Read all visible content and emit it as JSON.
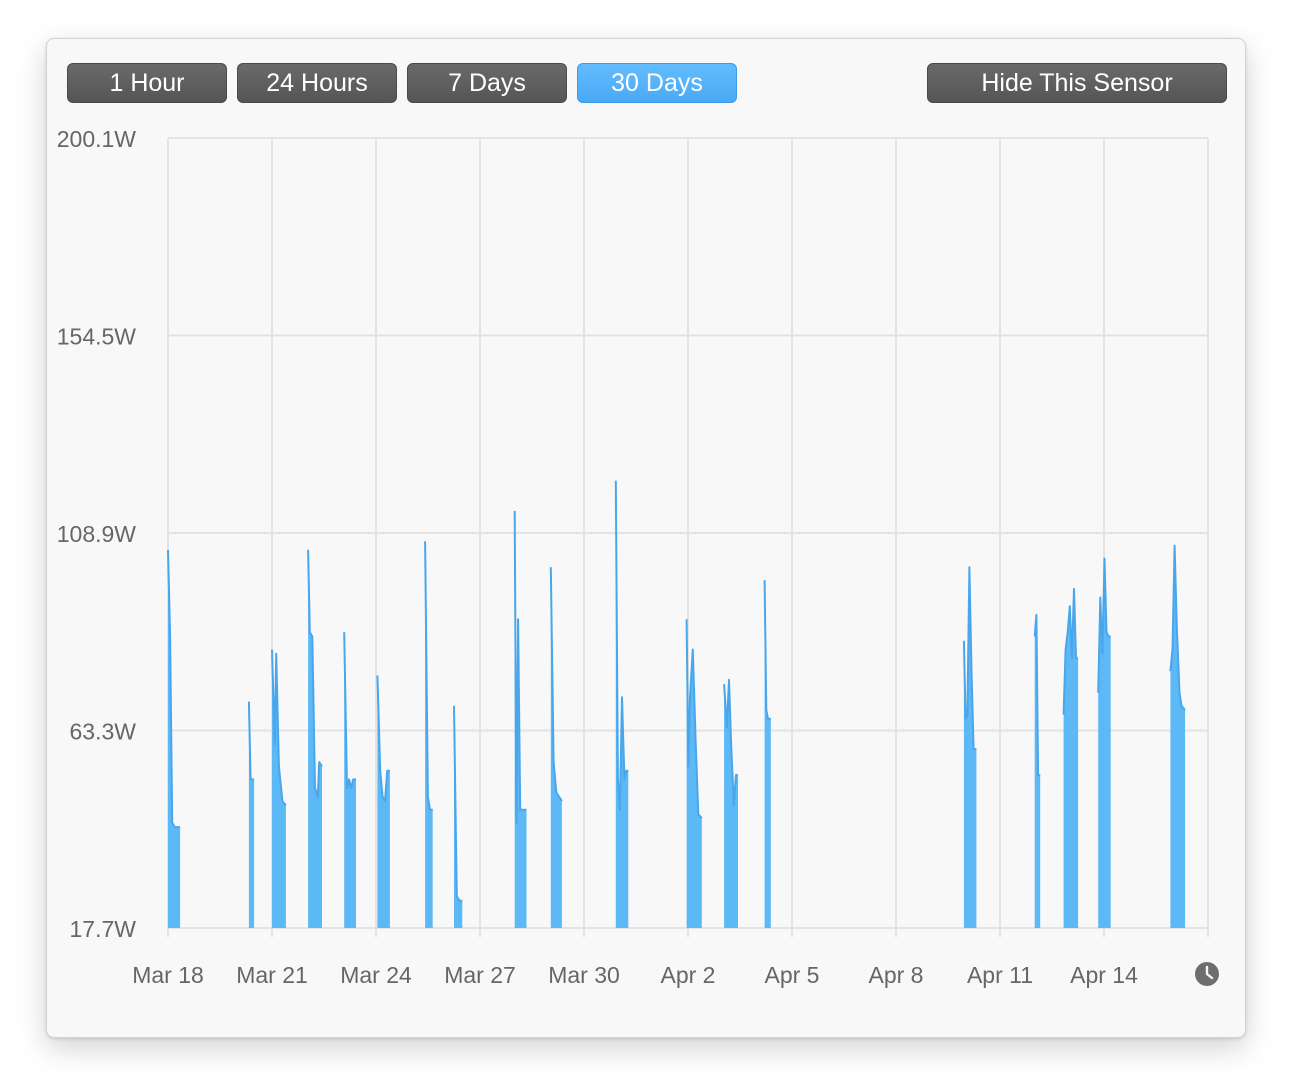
{
  "toolbar": {
    "ranges": [
      "1 Hour",
      "24 Hours",
      "7 Days",
      "30 Days"
    ],
    "selected": "30 Days",
    "hide_label": "Hide This Sensor"
  },
  "colors": {
    "accent": "#5db8f6",
    "line": "#4aa6ea",
    "grid": "#e3e3e3",
    "text": "#666666",
    "button": "#5c5c5c"
  },
  "icons": {
    "time": "clock-icon"
  },
  "chart_data": {
    "type": "area",
    "title": "",
    "xlabel": "",
    "ylabel": "",
    "y_ticks": [
      "200.1W",
      "154.5W",
      "108.9W",
      "63.3W",
      "17.7W"
    ],
    "ylim": [
      17.7,
      200.1
    ],
    "x_ticks": [
      "Mar 18",
      "Mar 21",
      "Mar 24",
      "Mar 27",
      "Mar 30",
      "Apr 2",
      "Apr 5",
      "Apr 8",
      "Apr 11",
      "Apr 14"
    ],
    "xlim": [
      "2024-03-18",
      "2024-04-17"
    ],
    "grid": true,
    "unit": "W",
    "series": [
      {
        "bursts": [
          {
            "start": "2024-03-18 00:00",
            "points": [
              [
                0,
                105
              ],
              [
                0.06,
                85
              ],
              [
                0.12,
                42
              ],
              [
                0.2,
                41
              ],
              [
                0.35,
                41
              ]
            ]
          },
          {
            "start": "2024-03-20 08:00",
            "points": [
              [
                0,
                70
              ],
              [
                0.05,
                52
              ],
              [
                0.15,
                52
              ]
            ]
          },
          {
            "start": "2024-03-21 00:00",
            "points": [
              [
                0,
                82
              ],
              [
                0.08,
                60
              ],
              [
                0.12,
                81
              ],
              [
                0.2,
                55
              ],
              [
                0.3,
                47
              ],
              [
                0.4,
                46
              ]
            ]
          },
          {
            "start": "2024-03-22 01:00",
            "points": [
              [
                0,
                105
              ],
              [
                0.05,
                86
              ],
              [
                0.12,
                85
              ],
              [
                0.2,
                50
              ],
              [
                0.28,
                48
              ],
              [
                0.32,
                56
              ],
              [
                0.4,
                55
              ]
            ]
          },
          {
            "start": "2024-03-23 02:00",
            "points": [
              [
                0,
                86
              ],
              [
                0.08,
                50
              ],
              [
                0.14,
                52
              ],
              [
                0.2,
                50
              ],
              [
                0.26,
                52
              ],
              [
                0.34,
                52
              ]
            ]
          },
          {
            "start": "2024-03-24 01:00",
            "points": [
              [
                0,
                76
              ],
              [
                0.08,
                54
              ],
              [
                0.15,
                48
              ],
              [
                0.22,
                47
              ],
              [
                0.28,
                54
              ],
              [
                0.36,
                54
              ]
            ]
          },
          {
            "start": "2024-03-25 10:00",
            "points": [
              [
                0,
                107
              ],
              [
                0.08,
                48
              ],
              [
                0.14,
                45
              ],
              [
                0.22,
                45
              ]
            ]
          },
          {
            "start": "2024-03-26 06:00",
            "points": [
              [
                0,
                69
              ],
              [
                0.08,
                25
              ],
              [
                0.16,
                24
              ],
              [
                0.24,
                24
              ]
            ]
          },
          {
            "start": "2024-03-28 00:00",
            "points": [
              [
                0,
                114
              ],
              [
                0.05,
                42
              ],
              [
                0.1,
                89
              ],
              [
                0.16,
                45
              ],
              [
                0.24,
                45
              ],
              [
                0.34,
                45
              ]
            ]
          },
          {
            "start": "2024-03-29 01:00",
            "points": [
              [
                0,
                101
              ],
              [
                0.08,
                56
              ],
              [
                0.16,
                49
              ],
              [
                0.24,
                48
              ],
              [
                0.32,
                47
              ]
            ]
          },
          {
            "start": "2024-03-30 22:00",
            "points": [
              [
                0,
                121
              ],
              [
                0.06,
                52
              ],
              [
                0.12,
                45
              ],
              [
                0.18,
                71
              ],
              [
                0.25,
                52
              ],
              [
                0.3,
                54
              ],
              [
                0.36,
                54
              ]
            ]
          },
          {
            "start": "2024-04-01 23:00",
            "points": [
              [
                0,
                89
              ],
              [
                0.05,
                55
              ],
              [
                0.1,
                71
              ],
              [
                0.18,
                82
              ],
              [
                0.26,
                61
              ],
              [
                0.34,
                44
              ],
              [
                0.44,
                43
              ]
            ]
          },
          {
            "start": "2024-04-03 01:00",
            "points": [
              [
                0,
                74
              ],
              [
                0.08,
                64
              ],
              [
                0.14,
                75
              ],
              [
                0.2,
                61
              ],
              [
                0.28,
                46
              ],
              [
                0.34,
                53
              ],
              [
                0.4,
                53
              ]
            ]
          },
          {
            "start": "2024-04-04 05:00",
            "points": [
              [
                0,
                98
              ],
              [
                0.05,
                68
              ],
              [
                0.1,
                66
              ],
              [
                0.18,
                66
              ]
            ]
          },
          {
            "start": "2024-04-09 23:00",
            "points": [
              [
                0,
                84
              ],
              [
                0.05,
                66
              ],
              [
                0.1,
                67
              ],
              [
                0.16,
                101
              ],
              [
                0.22,
                77
              ],
              [
                0.28,
                59
              ],
              [
                0.36,
                59
              ]
            ]
          },
          {
            "start": "2024-04-12 00:00",
            "points": [
              [
                0,
                85
              ],
              [
                0.05,
                90
              ],
              [
                0.1,
                53
              ],
              [
                0.16,
                53
              ]
            ]
          },
          {
            "start": "2024-04-12 20:00",
            "points": [
              [
                0,
                67
              ],
              [
                0.06,
                82
              ],
              [
                0.12,
                86
              ],
              [
                0.18,
                92
              ],
              [
                0.24,
                80
              ],
              [
                0.3,
                96
              ],
              [
                0.36,
                80
              ],
              [
                0.42,
                80
              ]
            ]
          },
          {
            "start": "2024-04-13 20:00",
            "points": [
              [
                0,
                72
              ],
              [
                0.06,
                94
              ],
              [
                0.12,
                81
              ],
              [
                0.18,
                103
              ],
              [
                0.24,
                86
              ],
              [
                0.3,
                85
              ],
              [
                0.36,
                85
              ]
            ]
          },
          {
            "start": "2024-04-15 22:00",
            "points": [
              [
                0,
                77
              ],
              [
                0.06,
                82
              ],
              [
                0.12,
                106
              ],
              [
                0.18,
                88
              ],
              [
                0.26,
                72
              ],
              [
                0.32,
                69
              ],
              [
                0.42,
                68
              ]
            ]
          }
        ]
      }
    ]
  }
}
